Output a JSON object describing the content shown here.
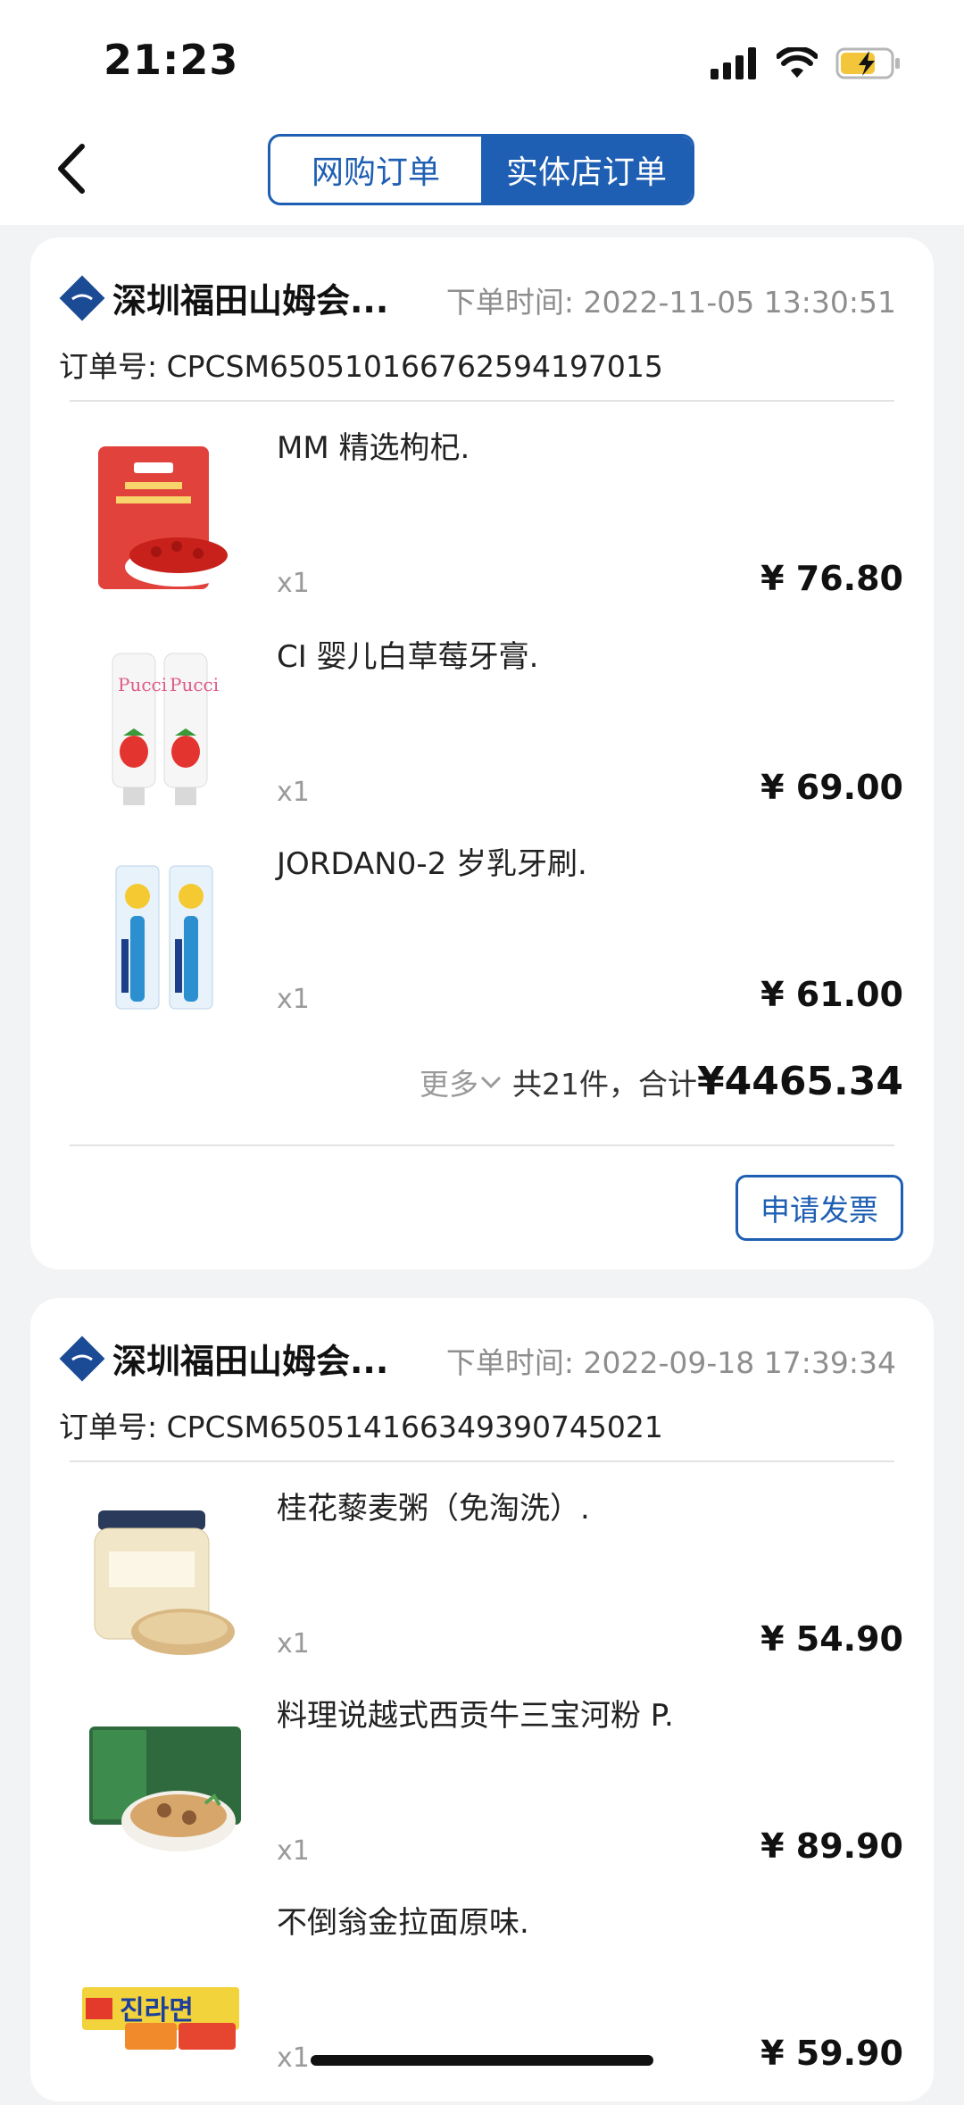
{
  "status_bar": {
    "time": "21:23"
  },
  "tabs": {
    "online": "网购订单",
    "store": "实体店订单"
  },
  "orders": [
    {
      "store": "深圳福田山姆会...",
      "order_time": "下单时间: 2022-11-05 13:30:51",
      "order_no": "订单号: CPCSM65051016676259419701​5",
      "items": [
        {
          "name": "MM 精选枸杞.",
          "qty": "x1",
          "price": "¥ 76.80"
        },
        {
          "name": "CI 婴儿白草莓牙膏.",
          "qty": "x1",
          "price": "¥ 69.00"
        },
        {
          "name": "JORDAN0-2 岁乳牙刷.",
          "qty": "x1",
          "price": "¥ 61.00"
        }
      ],
      "more": "更多",
      "summary_count": "共21件，合计",
      "total": "¥4465.34",
      "invoice_button": "申请发票"
    },
    {
      "store": "深圳福田山姆会...",
      "order_time": "下单时间: 2022-09-18 17:39:34",
      "order_no": "订单号: CPCSM650514166349390745021",
      "items": [
        {
          "name": "桂花藜麦粥（免淘洗）.",
          "qty": "x1",
          "price": "¥ 54.90"
        },
        {
          "name": "料理说越式西贡牛三宝河粉 P.",
          "qty": "x1",
          "price": "¥ 89.90"
        },
        {
          "name": "不倒翁金拉面原味.",
          "qty": "x1",
          "price": "¥ 59.90"
        }
      ]
    }
  ]
}
